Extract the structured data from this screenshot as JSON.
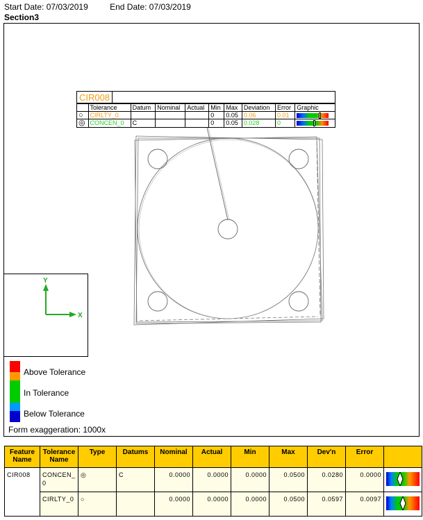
{
  "header": {
    "start_date": "Start Date: 07/03/2019",
    "end_date": "End Date: 07/03/2019",
    "section": "Section3"
  },
  "fcf": {
    "title": "CIR008",
    "columns": [
      "Tolerance",
      "Datum",
      "Nominal",
      "Actual",
      "Min",
      "Max",
      "Deviation",
      "Error",
      "Graphic"
    ],
    "rows": [
      {
        "symbol": "○",
        "tolerance": "CIRLTY_0",
        "datum": "",
        "nominal": "",
        "actual": "",
        "min": "0",
        "max": "0.05",
        "deviation": "0.06",
        "error": "0.01",
        "color": "#f39c12"
      },
      {
        "symbol": "◎",
        "tolerance": "CONCEN_0",
        "datum": "C",
        "nominal": "",
        "actual": "",
        "min": "0",
        "max": "0.05",
        "deviation": "0.028",
        "error": "0",
        "color": "#2ecc2e"
      }
    ]
  },
  "axes": {
    "y_label": "Y",
    "x_label": "X"
  },
  "legend": {
    "above": "Above Tolerance",
    "in": "In Tolerance",
    "below": "Below Tolerance",
    "colors": [
      "#ff0000",
      "#ff9900",
      "#00cc00",
      "#00cc00",
      "#00cc00",
      "#0099ff",
      "#0000cc"
    ]
  },
  "exaggeration": "Form exaggeration: 1000x",
  "results": {
    "headers": [
      "Feature Name",
      "Tolerance Name",
      "Type",
      "Datums",
      "Nominal",
      "Actual",
      "Min",
      "Max",
      "Dev'n",
      "Error",
      ""
    ],
    "feature": "CIR008",
    "rows": [
      {
        "tolerance": "CONCEN_0",
        "type": "◎",
        "datums": "C",
        "nominal": "0.0000",
        "actual": "0.0000",
        "min": "0.0000",
        "max": "0.0500",
        "devn": "0.0280",
        "error": "0.0000"
      },
      {
        "tolerance": "CIRLTY_0",
        "type": "○",
        "datums": "",
        "nominal": "0.0000",
        "actual": "0.0000",
        "min": "0.0000",
        "max": "0.0500",
        "devn": "0.0597",
        "error": "0.0097"
      }
    ]
  }
}
